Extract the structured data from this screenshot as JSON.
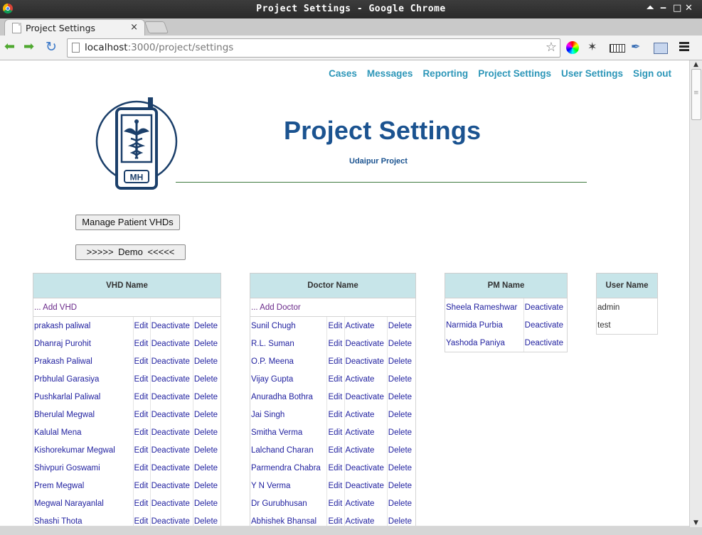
{
  "window": {
    "title": "Project Settings - Google Chrome"
  },
  "window_controls": {
    "up": "⏶",
    "minimize": "‒",
    "maximize": "□",
    "close": "✕"
  },
  "tab": {
    "title": "Project Settings",
    "close": "×"
  },
  "address": {
    "host": "localhost",
    "path": ":3000/project/settings"
  },
  "nav": [
    "Cases",
    "Messages",
    "Reporting",
    "Project Settings",
    "User Settings",
    "Sign out"
  ],
  "logo": {
    "text": "MH"
  },
  "page": {
    "title": "Project Settings",
    "project": "Udaipur Project"
  },
  "buttons": {
    "manage": "Manage Patient VHDs",
    "demo": ">>>>>   Demo   <<<<<"
  },
  "vhd": {
    "header": "VHD Name",
    "add": "... Add VHD",
    "rows": [
      {
        "name": "prakash paliwal",
        "edit": "Edit",
        "status": "Deactivate",
        "delete": "Delete"
      },
      {
        "name": "Dhanraj Purohit",
        "edit": "Edit",
        "status": "Deactivate",
        "delete": "Delete"
      },
      {
        "name": "Prakash Paliwal",
        "edit": "Edit",
        "status": "Deactivate",
        "delete": "Delete"
      },
      {
        "name": "Prbhulal Garasiya",
        "edit": "Edit",
        "status": "Deactivate",
        "delete": "Delete"
      },
      {
        "name": "Pushkarlal Paliwal",
        "edit": "Edit",
        "status": "Deactivate",
        "delete": "Delete"
      },
      {
        "name": "Bherulal Megwal",
        "edit": "Edit",
        "status": "Deactivate",
        "delete": "Delete"
      },
      {
        "name": "Kalulal Mena",
        "edit": "Edit",
        "status": "Deactivate",
        "delete": "Delete"
      },
      {
        "name": "Kishorekumar Megwal",
        "edit": "Edit",
        "status": "Deactivate",
        "delete": "Delete"
      },
      {
        "name": "Shivpuri Goswami",
        "edit": "Edit",
        "status": "Deactivate",
        "delete": "Delete"
      },
      {
        "name": "Prem Megwal",
        "edit": "Edit",
        "status": "Deactivate",
        "delete": "Delete"
      },
      {
        "name": "Megwal Narayanlal",
        "edit": "Edit",
        "status": "Deactivate",
        "delete": "Delete"
      },
      {
        "name": "Shashi Thota",
        "edit": "Edit",
        "status": "Deactivate",
        "delete": "Delete"
      }
    ]
  },
  "doctor": {
    "header": "Doctor Name",
    "add": "... Add Doctor",
    "rows": [
      {
        "name": "Sunil Chugh",
        "edit": "Edit",
        "status": "Activate",
        "delete": "Delete"
      },
      {
        "name": "R.L. Suman",
        "edit": "Edit",
        "status": "Deactivate",
        "delete": "Delete"
      },
      {
        "name": "O.P. Meena",
        "edit": "Edit",
        "status": "Deactivate",
        "delete": "Delete"
      },
      {
        "name": "Vijay Gupta",
        "edit": "Edit",
        "status": "Activate",
        "delete": "Delete"
      },
      {
        "name": "Anuradha Bothra",
        "edit": "Edit",
        "status": "Deactivate",
        "delete": "Delete"
      },
      {
        "name": "Jai Singh",
        "edit": "Edit",
        "status": "Activate",
        "delete": "Delete"
      },
      {
        "name": "Smitha Verma",
        "edit": "Edit",
        "status": "Activate",
        "delete": "Delete"
      },
      {
        "name": "Lalchand Charan",
        "edit": "Edit",
        "status": "Activate",
        "delete": "Delete"
      },
      {
        "name": "Parmendra Chabra",
        "edit": "Edit",
        "status": "Deactivate",
        "delete": "Delete"
      },
      {
        "name": "Y N Verma",
        "edit": "Edit",
        "status": "Deactivate",
        "delete": "Delete"
      },
      {
        "name": "Dr Gurubhusan",
        "edit": "Edit",
        "status": "Activate",
        "delete": "Delete"
      },
      {
        "name": "Abhishek Bhansal",
        "edit": "Edit",
        "status": "Activate",
        "delete": "Delete"
      }
    ]
  },
  "pm": {
    "header": "PM Name",
    "rows": [
      {
        "name": "Sheela Rameshwar",
        "status": "Deactivate"
      },
      {
        "name": "Narmida Purbia",
        "status": "Deactivate"
      },
      {
        "name": "Yashoda Paniya",
        "status": "Deactivate"
      }
    ]
  },
  "users": {
    "header": "User Name",
    "rows": [
      "admin",
      "test"
    ]
  },
  "colors": {
    "nav_link": "#2c96b8",
    "title": "#1b5390",
    "table_header": "#c7e5e9",
    "link": "#2222a0"
  }
}
